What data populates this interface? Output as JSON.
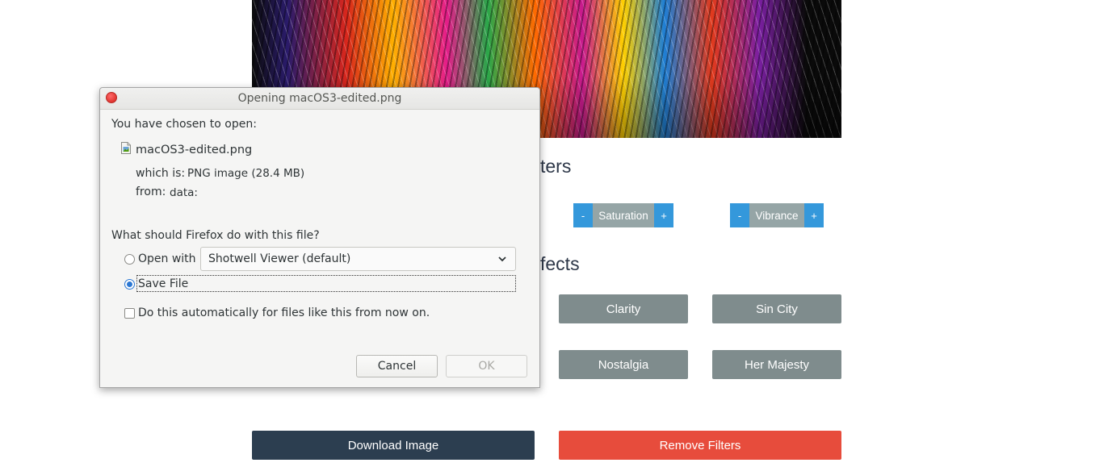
{
  "app": {
    "section_filters_partial": "ters",
    "section_effects_partial": "fects",
    "adjustments": [
      {
        "minus": "-",
        "label": "Saturation",
        "plus": "+"
      },
      {
        "minus": "-",
        "label": "Vibrance",
        "plus": "+"
      }
    ],
    "effects": [
      "Clarity",
      "Sin City",
      "Nostalgia",
      "Her Majesty"
    ],
    "download_label": "Download Image",
    "remove_label": "Remove Filters",
    "colors": {
      "primary_dark": "#2c3e50",
      "danger": "#e74c3c",
      "adjust_blue": "#3498db",
      "effect_gray": "#7f8c8d"
    }
  },
  "dialog": {
    "title": "Opening macOS3-edited.png",
    "intro": "You have chosen to open:",
    "file_name": "macOS3-edited.png",
    "which_is_label": "which is:",
    "which_is_value": "PNG image (28.4 MB)",
    "from_label": "from:",
    "from_value": "data:",
    "question": "What should Firefox do with this file?",
    "open_with_label": "Open with",
    "open_with_app": "Shotwell Viewer (default)",
    "save_file_label": "Save File",
    "auto_label": "Do this automatically for files like this from now on.",
    "cancel_label": "Cancel",
    "ok_label": "OK",
    "selected_option": "save_file",
    "auto_checked": false
  }
}
